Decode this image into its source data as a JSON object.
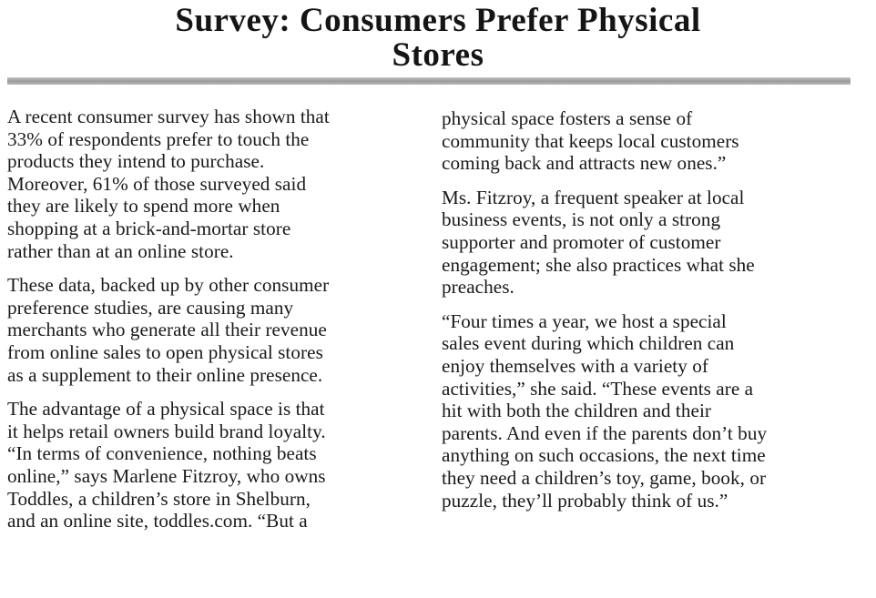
{
  "article": {
    "headline_lines": [
      "Survey: Consumers Prefer Physical",
      "Stores"
    ],
    "left_column": [
      [
        "A recent consumer survey has shown that",
        "33% of respondents prefer to touch the",
        "products they intend to purchase.",
        "Moreover, 61% of those surveyed said",
        "they are likely to spend more when",
        "shopping at a brick-and-mortar store",
        "rather than at an online store."
      ],
      [
        "These data, backed up by other consumer",
        "preference studies, are causing many",
        "merchants who generate all their revenue",
        "from online sales to open physical stores",
        "as a supplement to their online presence."
      ],
      [
        "The advantage of a physical space is that",
        "it helps retail owners build brand loyalty.",
        "“In terms of convenience, nothing beats",
        "online,” says Marlene Fitzroy, who owns",
        "Toddles, a children’s store in Shelburn,",
        "and an online site, toddles.com. “But a"
      ]
    ],
    "right_column": [
      [
        "physical space fosters a sense of",
        "community that keeps local customers",
        "coming back and attracts new ones.”"
      ],
      [
        "Ms. Fitzroy, a frequent speaker at local",
        "business events, is not only a strong",
        "supporter and promoter of customer",
        "engagement; she also practices what she",
        "preaches."
      ],
      [
        "“Four times a year, we host a special",
        "sales event during which children can",
        "enjoy themselves with a variety of",
        "activities,” she said. “These events are a",
        "hit with both the children and their",
        "parents. And even if the parents don’t buy",
        "anything on such occasions, the next time",
        "they need a children’s toy, game, book, or",
        "puzzle, they’ll probably think of us.”"
      ]
    ]
  }
}
